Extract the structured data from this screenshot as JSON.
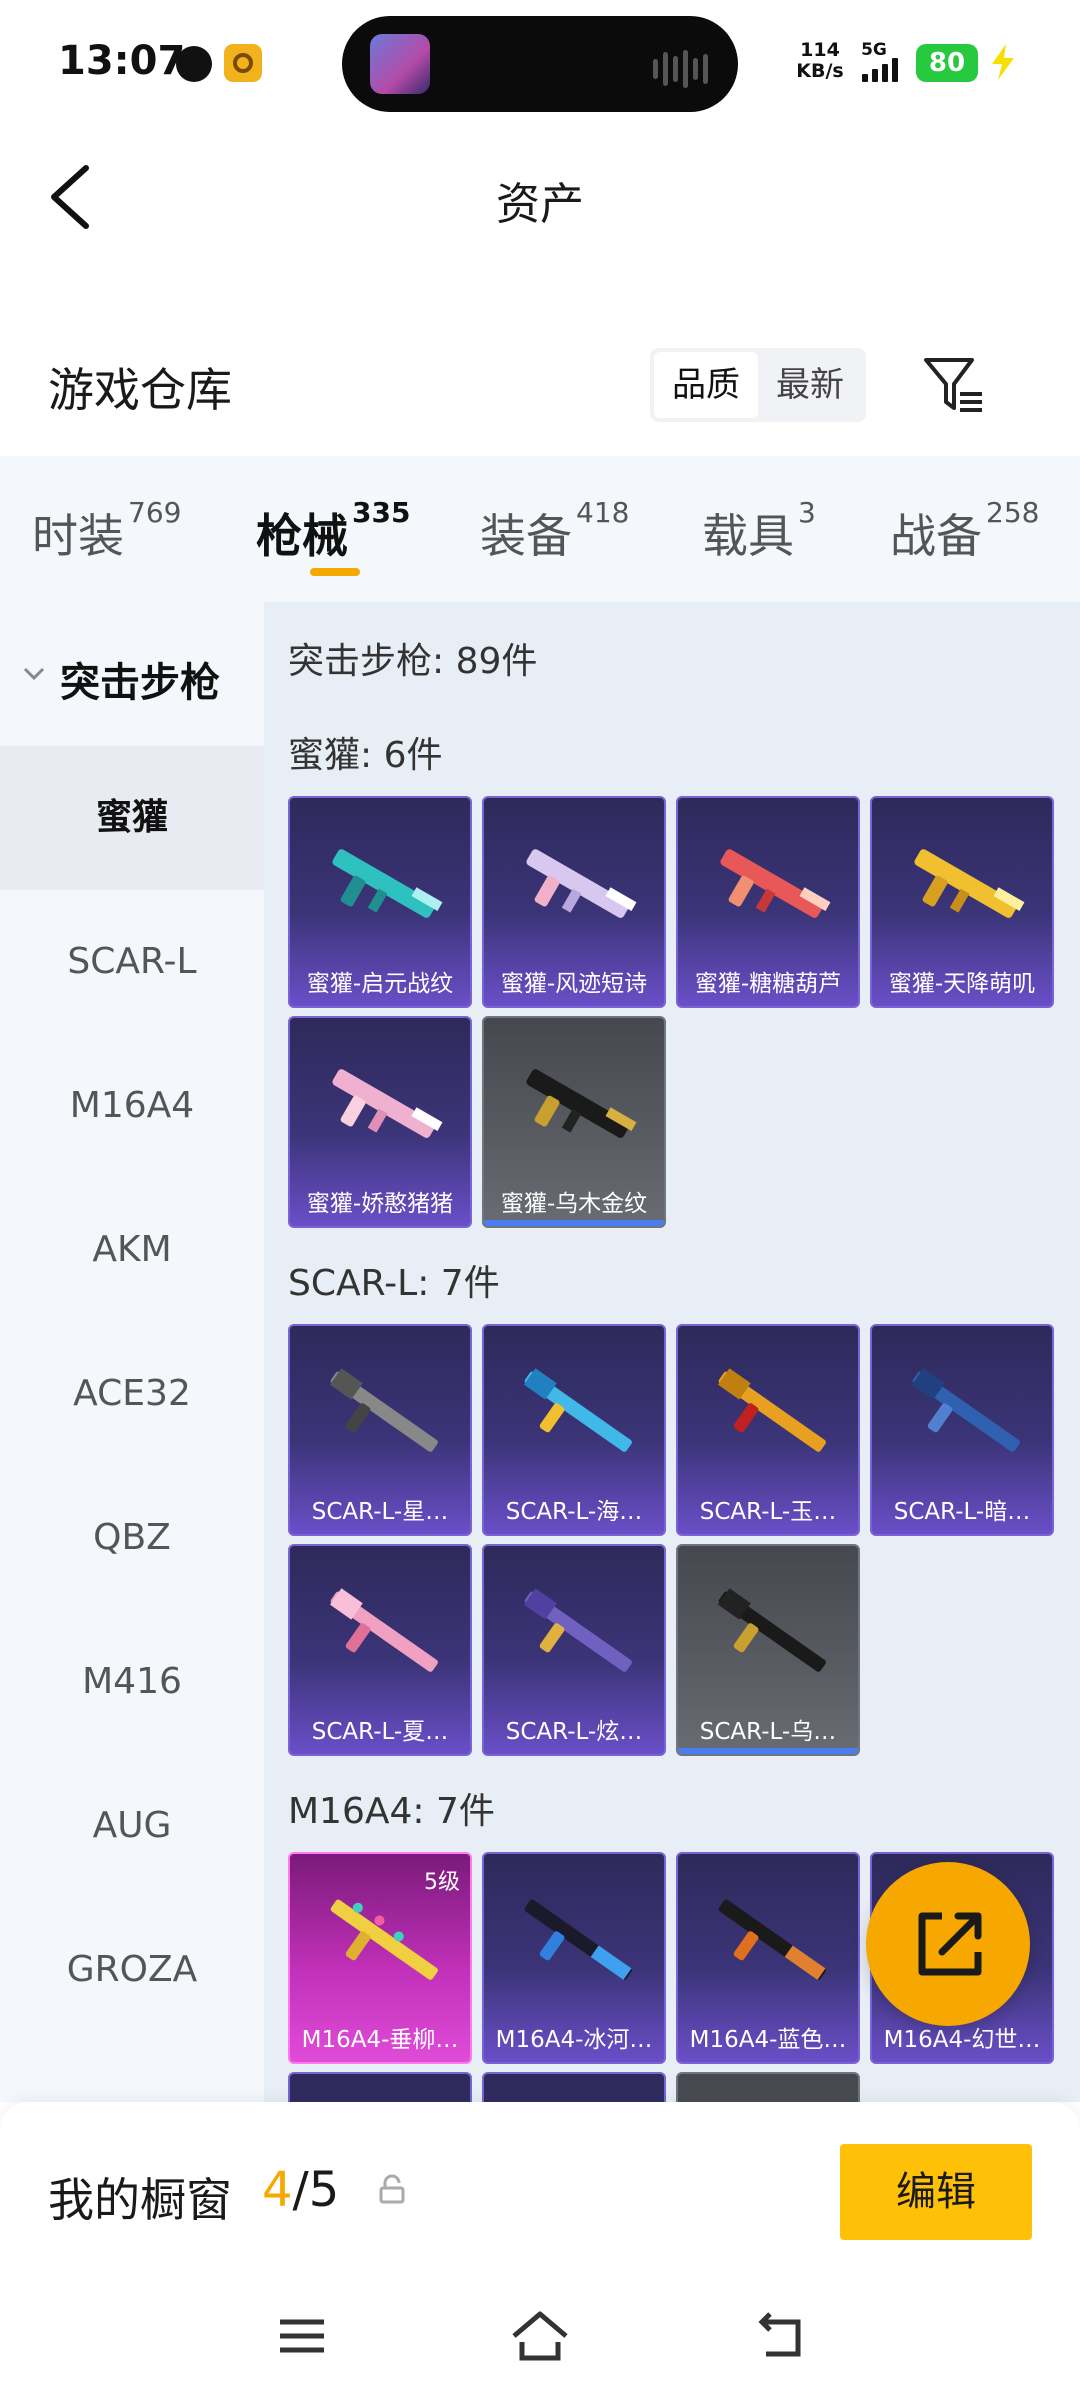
{
  "status_bar": {
    "time": "13:07",
    "net_speed_value": "114",
    "net_speed_unit": "KB/s",
    "network": "5G",
    "battery": "80"
  },
  "header": {
    "title": "资产"
  },
  "section": {
    "title": "游戏仓库",
    "sort_options": [
      "品质",
      "最新"
    ],
    "sort_selected": "品质"
  },
  "tabs": [
    {
      "label": "时装",
      "count": "769"
    },
    {
      "label": "枪械",
      "count": "335"
    },
    {
      "label": "装备",
      "count": "418"
    },
    {
      "label": "载具",
      "count": "3"
    },
    {
      "label": "战备",
      "count": "258"
    }
  ],
  "side_menu": {
    "group": "突击步枪",
    "items": [
      "蜜獾",
      "SCAR-L",
      "M16A4",
      "AKM",
      "ACE32",
      "QBZ",
      "M416",
      "AUG",
      "GROZA"
    ]
  },
  "content": {
    "category_count": "突击步枪: 89件",
    "groups": [
      {
        "label": "蜜獾: 6件",
        "items": [
          {
            "name": "蜜獾-启元战纹"
          },
          {
            "name": "蜜獾-风迹短诗"
          },
          {
            "name": "蜜獾-糖糖葫芦"
          },
          {
            "name": "蜜獾-天降萌叽"
          },
          {
            "name": "蜜獾-娇憨猪猪"
          },
          {
            "name": "蜜獾-乌木金纹"
          }
        ]
      },
      {
        "label": "SCAR-L: 7件",
        "items": [
          {
            "name": "SCAR-L-星…"
          },
          {
            "name": "SCAR-L-海…"
          },
          {
            "name": "SCAR-L-玉…"
          },
          {
            "name": "SCAR-L-暗…"
          },
          {
            "name": "SCAR-L-夏…"
          },
          {
            "name": "SCAR-L-炫…"
          },
          {
            "name": "SCAR-L-乌…"
          }
        ]
      },
      {
        "label": "M16A4: 7件",
        "items": [
          {
            "name": "M16A4-垂柳…",
            "level": "5级"
          },
          {
            "name": "M16A4-冰河…"
          },
          {
            "name": "M16A4-蓝色…"
          },
          {
            "name": "M16A4-幻世…"
          }
        ]
      }
    ]
  },
  "showcase": {
    "label": "我的橱窗",
    "current": "4",
    "total": "/5",
    "edit_label": "编辑"
  }
}
